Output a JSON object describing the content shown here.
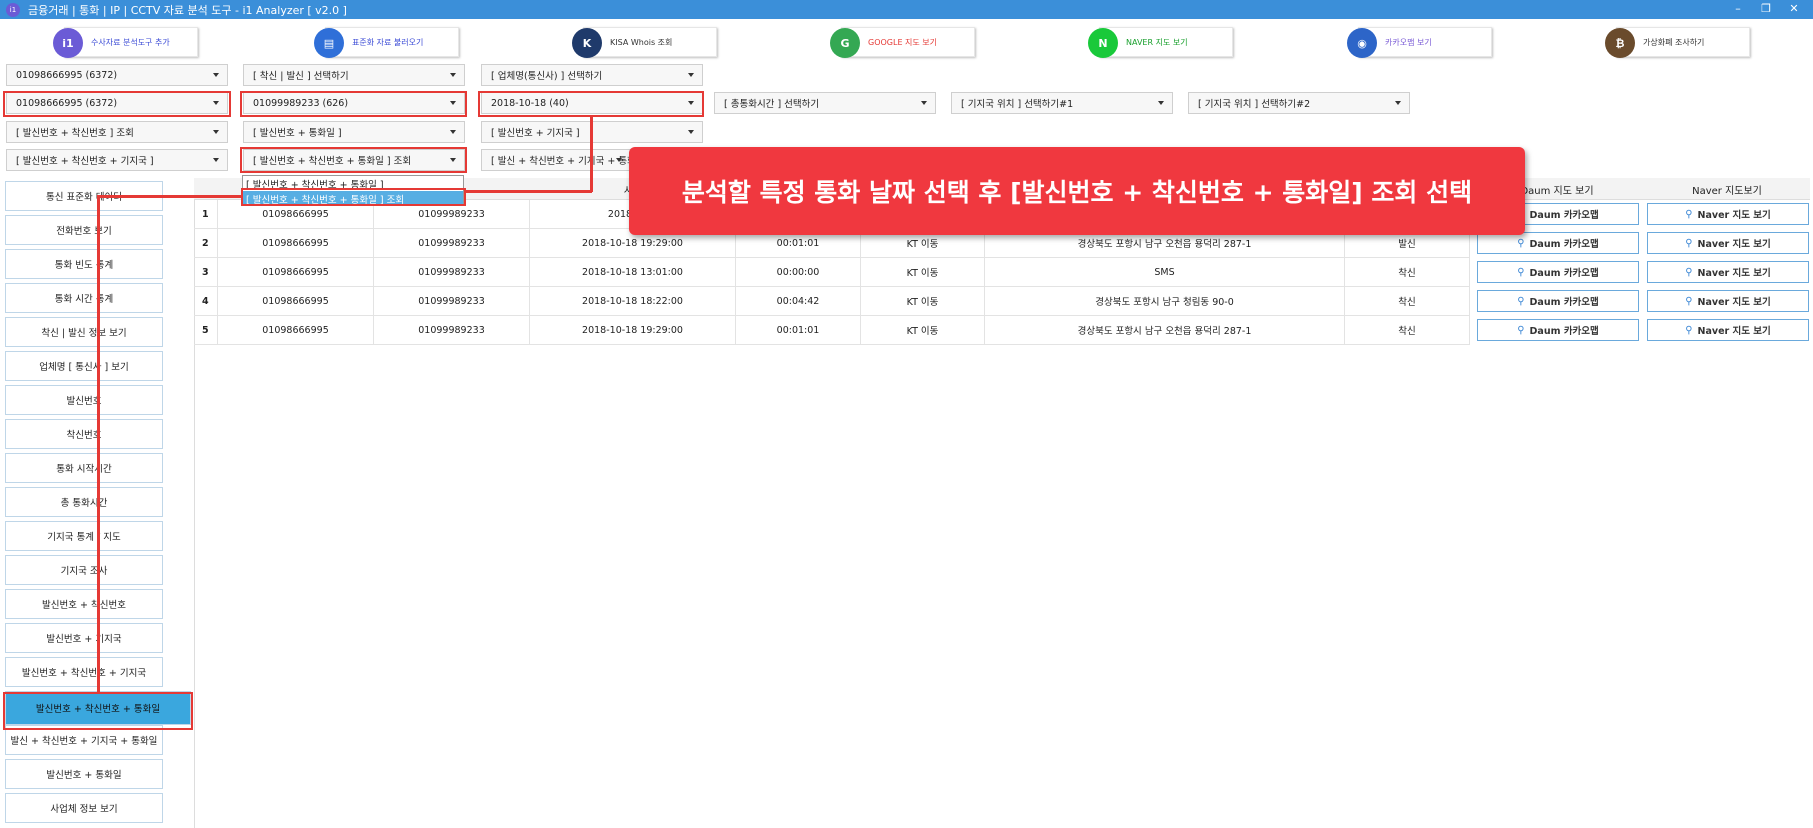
{
  "window": {
    "title": "금융거래 | 통화 | IP | CCTV 자료 분석 도구 - i1 Analyzer [ v2.0 ]",
    "app_icon": "i1",
    "controls": {
      "minimize": "–",
      "restore": "❐",
      "close": "✕"
    }
  },
  "toolbar": [
    {
      "label": "수사자료 분석도구 추가",
      "icon": "i1",
      "color": "#6b5bd6"
    },
    {
      "label": "표준화 자료 불러오기",
      "icon": "▤",
      "color": "#2f6fd8"
    },
    {
      "label": "KISA Whois 조회",
      "icon": "K",
      "color": "#1f3a6b"
    },
    {
      "label": "GOOGLE 지도 보기",
      "icon": "G",
      "color": "#34a853"
    },
    {
      "label": "NAVER 지도 보기",
      "icon": "N",
      "color": "#19c93a"
    },
    {
      "label": "카카오맵 보기",
      "icon": "◉",
      "color": "#2d65c8"
    },
    {
      "label": "가상화폐 조사하기",
      "icon": "₿",
      "color": "#6a4b2c"
    }
  ],
  "toolbar_label_colors": [
    "#3b4bd6",
    "#3b4bd6",
    "#333333",
    "#e53935",
    "#19a02d",
    "#7a5bd6",
    "#333333"
  ],
  "combos": {
    "row1": [
      "01098666995 (6372)",
      "[ 착신 | 발신 ] 선택하기",
      "[ 업체명(통신사) ] 선택하기"
    ],
    "row2": [
      "01098666995 (6372)",
      "01099989233 (626)",
      "2018-10-18 (40)",
      "[ 총통화시간 ] 선택하기",
      "[ 기지국 위치 ] 선택하기#1",
      "[ 기지국 위치 ] 선택하기#2"
    ],
    "row3": [
      "[ 발신번호 + 착신번호 ] 조회",
      "[ 발신번호 + 통화일 ]",
      "[ 발신번호 + 기지국 ]"
    ],
    "row4": [
      "[ 발신번호 + 착신번호 + 기지국 ]",
      "[ 발신번호 + 착신번호 + 통화일 ] 조회",
      "[ 발신 + 착신번호 + 기지국 + 통화일 ]"
    ]
  },
  "dropdown": {
    "options": [
      "[ 발신번호 + 착신번호 + 통화일 ]",
      "[ 발신번호 + 착신번호 + 통화일 ] 조회"
    ],
    "selected_index": 1
  },
  "sidebar": {
    "items": [
      "통신 표준화 데이터",
      "전화번호 보기",
      "통화 빈도 통계",
      "통화 시간 통계",
      "착신 | 발신 정보 보기",
      "업체명 [ 통신사 ] 보기",
      "발신번호",
      "착신번호",
      "통화 시작시간",
      "총 통화시간",
      "기지국 통계 / 지도",
      "기지국 조사",
      "발신번호 + 착신번호",
      "발신번호 + 기지국",
      "발신번호 + 착신번호 + 기지국",
      "발신번호 + 착신번호 + 통화일",
      "발신 + 착신번호 + 기지국 + 통화일",
      "발신번호 + 통화일",
      "사업체 정보 보기"
    ],
    "active_index": 15
  },
  "grid": {
    "headers": [
      "",
      "",
      "",
      "시작",
      "",
      "",
      "",
      "",
      "Daum 지도 보기",
      "Naver 지도보기"
    ],
    "rows": [
      {
        "no": "1",
        "caller": "01098666995",
        "callee": "01099989233",
        "start": "2018-10-1",
        "duration": "",
        "carrier": "",
        "location": "",
        "type": ""
      },
      {
        "no": "2",
        "caller": "01098666995",
        "callee": "01099989233",
        "start": "2018-10-18 19:29:00",
        "duration": "00:01:01",
        "carrier": "KT 이동",
        "location": "경상북도 포항시 남구 오천읍 용덕리 287-1",
        "type": "발신"
      },
      {
        "no": "3",
        "caller": "01098666995",
        "callee": "01099989233",
        "start": "2018-10-18 13:01:00",
        "duration": "00:00:00",
        "carrier": "KT 이동",
        "location": "SMS",
        "type": "착신"
      },
      {
        "no": "4",
        "caller": "01098666995",
        "callee": "01099989233",
        "start": "2018-10-18 18:22:00",
        "duration": "00:04:42",
        "carrier": "KT 이동",
        "location": "경상북도 포항시 남구 청림동 90-0",
        "type": "착신"
      },
      {
        "no": "5",
        "caller": "01098666995",
        "callee": "01099989233",
        "start": "2018-10-18 19:29:00",
        "duration": "00:01:01",
        "carrier": "KT 이동",
        "location": "경상북도 포항시 남구 오천읍 용덕리 287-1",
        "type": "착신"
      }
    ],
    "daum_button": "Daum 카카오맵",
    "naver_button": "Naver 지도 보기"
  },
  "callout": {
    "text": "분석할 특정 통화 날짜 선택 후 [발신번호 + 착신번호 + 통화일] 조회 선택"
  },
  "colors": {
    "titlebar": "#3b8fd9",
    "highlight": "#e53935",
    "active": "#3aa7de",
    "callout": "#f0383f"
  }
}
